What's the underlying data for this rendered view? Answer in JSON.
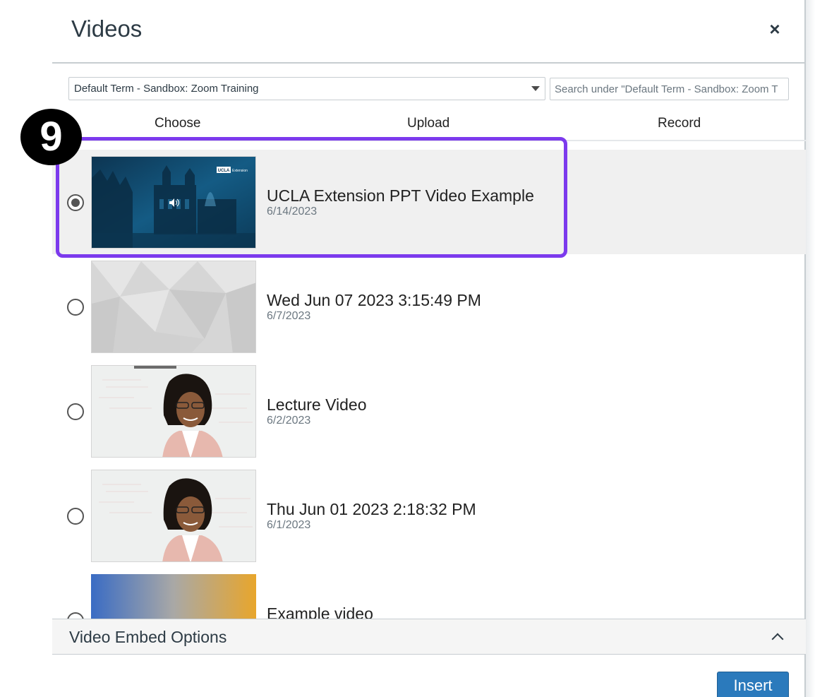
{
  "dialog": {
    "title": "Videos",
    "close_glyph": "×"
  },
  "toolbar": {
    "term_selected": "Default Term - Sandbox: Zoom Training",
    "search_placeholder": "Search under \"Default Term - Sandbox: Zoom T"
  },
  "tabs": [
    {
      "label": "Choose"
    },
    {
      "label": "Upload"
    },
    {
      "label": "Record"
    }
  ],
  "videos": [
    {
      "name": "UCLA Extension PPT Video Example",
      "date": "6/14/2023",
      "selected": true,
      "thumb_logo": "UCLA",
      "thumb_logo_sub": "Extension"
    },
    {
      "name": "Wed Jun 07 2023 3:15:49 PM",
      "date": "6/7/2023",
      "selected": false
    },
    {
      "name": "Lecture Video",
      "date": "6/2/2023",
      "selected": false
    },
    {
      "name": "Thu Jun 01 2023 2:18:32 PM",
      "date": "6/1/2023",
      "selected": false
    },
    {
      "name": "Example video",
      "date": "",
      "selected": false
    }
  ],
  "annotation": {
    "step_number": "9",
    "highlight_color": "#7c3aed"
  },
  "embed_options": {
    "label": "Video Embed Options",
    "expanded": true
  },
  "actions": {
    "insert_label": "Insert"
  },
  "colors": {
    "primary_button": "#2b7abc",
    "selected_row": "#f0f0f0",
    "text": "#2d3b45"
  }
}
